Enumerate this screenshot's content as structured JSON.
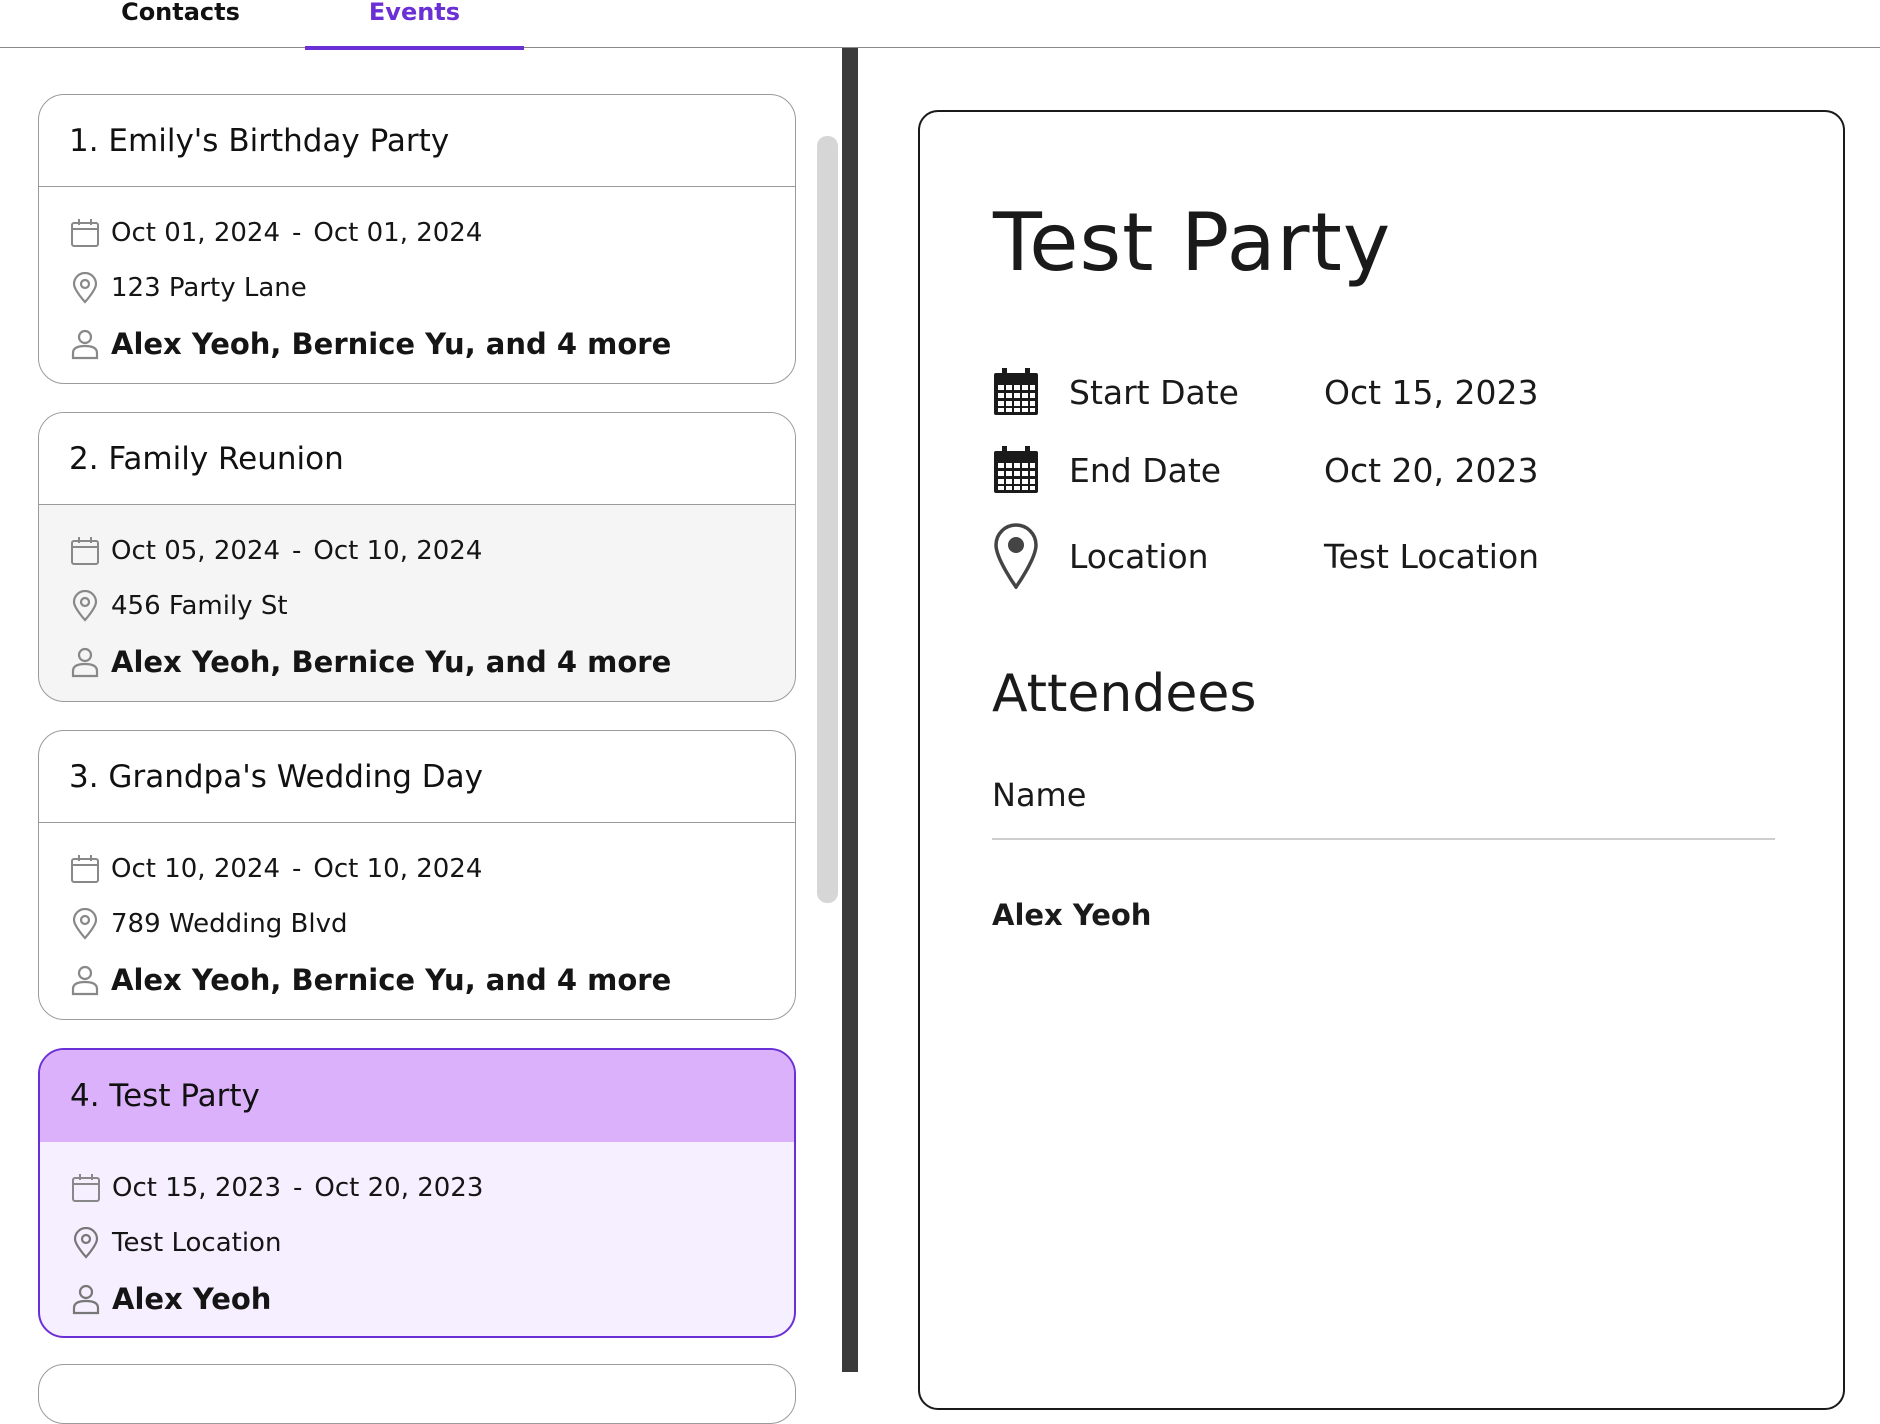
{
  "tabs": {
    "contacts": "Contacts",
    "events": "Events"
  },
  "events": [
    {
      "title": "1. Emily's Birthday Party",
      "start": "Oct 01, 2024",
      "end": "Oct 01, 2024",
      "date_separator": "-",
      "location": "123 Party Lane",
      "attendees": "Alex Yeoh, Bernice Yu, and 4 more"
    },
    {
      "title": "2. Family Reunion",
      "start": "Oct 05, 2024",
      "end": "Oct 10, 2024",
      "date_separator": "-",
      "location": "456 Family St",
      "attendees": "Alex Yeoh, Bernice Yu, and 4 more"
    },
    {
      "title": "3. Grandpa's Wedding Day",
      "start": "Oct 10, 2024",
      "end": "Oct 10, 2024",
      "date_separator": "-",
      "location": "789 Wedding Blvd",
      "attendees": "Alex Yeoh, Bernice Yu, and 4 more"
    },
    {
      "title": "4. Test Party",
      "start": "Oct 15, 2023",
      "end": "Oct 20, 2023",
      "date_separator": "-",
      "location": "Test Location",
      "attendees": "Alex Yeoh"
    }
  ],
  "selected_index": 3,
  "detail": {
    "title": "Test Party",
    "start_label": "Start Date",
    "start_value": "Oct 15, 2023",
    "end_label": "End Date",
    "end_value": "Oct 20, 2023",
    "location_label": "Location",
    "location_value": "Test Location",
    "attendees_heading": "Attendees",
    "attendees_column": "Name",
    "attendees": [
      "Alex Yeoh"
    ]
  },
  "colors": {
    "accent": "#6b2fd6",
    "selected_header": "#dcb1fb",
    "selected_body": "#f6efff"
  },
  "icons": {
    "calendar_small": "calendar-outline-icon",
    "pin_small": "map-pin-outline-icon",
    "person_small": "person-outline-icon",
    "calendar_big": "calendar-filled-icon",
    "pin_big": "map-pin-icon"
  }
}
